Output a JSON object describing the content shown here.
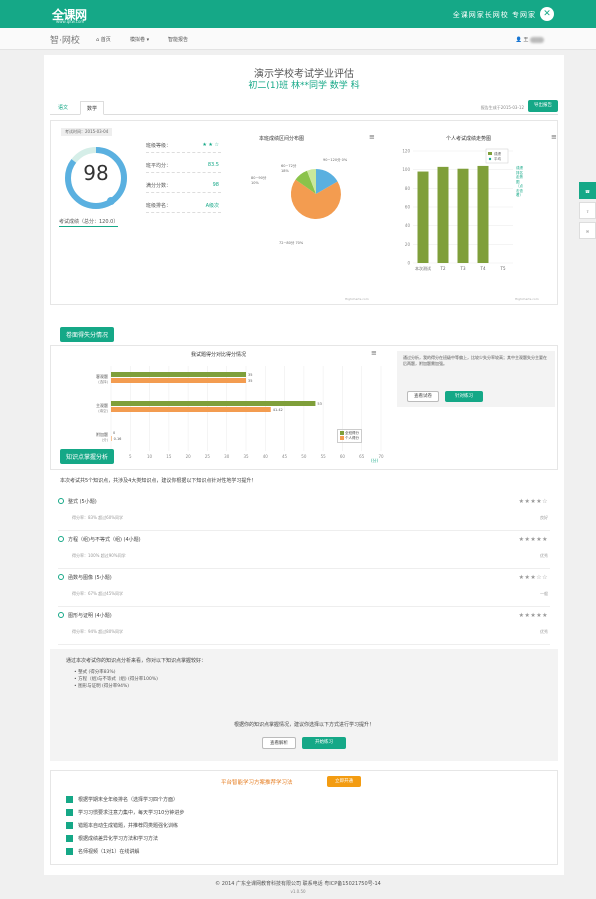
{
  "header": {
    "logo": "全课网",
    "logo_sub": "www.qkw.com",
    "slogan": "全课网家长网校 专网家",
    "close": "✕"
  },
  "nav": {
    "brand": "智·网校",
    "home": "首页",
    "mock": "模拟卷 ▾",
    "report": "智能报告",
    "user": "王"
  },
  "report": {
    "title": "演示学校考试学业评估",
    "subtitle": "初二(1)班 林**同学 数学 科",
    "tabs": [
      "语文",
      "数学"
    ],
    "generated": "报告生成于2015-03-12",
    "export_btn": "导出报告",
    "exam_time": "考试时间：2015-03-04",
    "score": "98",
    "score_label": "考试成绩（总分：120.0）",
    "stats": [
      {
        "k": "班级等级：",
        "v": "★ ★ ☆"
      },
      {
        "k": "班平均分：",
        "v": "83.5"
      },
      {
        "k": "满分分数：",
        "v": "98"
      },
      {
        "k": "班级排名：",
        "v": "A级次"
      }
    ],
    "pie": {
      "title": "本班成绩区间分布图",
      "labels": [
        "90~120分 0%",
        "80~90分 10%",
        "72~80分 70%",
        "60~72分 18%"
      ],
      "credit": "Highcharts.com"
    },
    "bar1": {
      "title": "个人考试成绩走势图",
      "legend": [
        "成绩",
        "平均"
      ],
      "ylabels": [
        "120",
        "100",
        "80",
        "60",
        "40",
        "20",
        "0"
      ],
      "xlabels": [
        "本次测试",
        "T2",
        "T3",
        "T4",
        "T5"
      ],
      "side": "成绩排名走势图 （点击查看）",
      "credit": "Highcharts.com"
    }
  },
  "section1": {
    "tag": "卷面得失分情况",
    "chart_title": "我试题得分对比得分情况",
    "rows": [
      {
        "l1": "客观题",
        "l2": "(选择)"
      },
      {
        "l1": "主观题",
        "l2": "(填空)"
      },
      {
        "l1": "附加题",
        "l2": "(分)"
      }
    ],
    "legend": [
      "全班得分",
      "个人得分"
    ],
    "unit": "(分)",
    "xticks": [
      "0",
      "5",
      "10",
      "15",
      "20",
      "25",
      "30",
      "35",
      "40",
      "45",
      "50",
      "55",
      "60",
      "65",
      "70"
    ],
    "note": "通过分析，我的得分在班级中等偏上，比较少失分率较高；其中主观题失分主要在后两题，附加题需加强。",
    "btn1": "查看试卷",
    "btn2": "针对练习"
  },
  "section2": {
    "tag": "知识点掌握分析",
    "intro": "本次考试共5个知识点，共涉及4大类知识点，建议你根据以下知识点针对性地学习提升！",
    "items": [
      {
        "name": "整式 (5小题)",
        "sub": "得分率：83%  超过60%同学",
        "stars": "★★★★☆",
        "mark": "良好"
      },
      {
        "name": "方程（组)与不等式（组) (4小题)",
        "sub": "得分率：100%  超过90%同学",
        "stars": "★★★★★",
        "mark": "优秀"
      },
      {
        "name": "函数与图像 (5小题)",
        "sub": "得分率：67%  超过45%同学",
        "stars": "★★★☆☆",
        "mark": "一般"
      },
      {
        "name": "图形与证明 (4小题)",
        "sub": "得分率：94%  超过80%同学",
        "stars": "★★★★★",
        "mark": "优秀"
      }
    ],
    "summary": "通过本次考试你的知识点分析来看，你对以下知识点掌握较好：",
    "points": [
      "整式 (得分率83%)",
      "方程（组)与不等式（组) (得分率100%)",
      "图形与证明 (得分率94%)"
    ],
    "tip": "根据你的知识点掌握情况，建议你选择以下方式进行学习提升！",
    "btn1": "查看解析",
    "btn2": "开始练习"
  },
  "plan": {
    "title": "平台智能学习方案推荐学习法",
    "btn": "立即开通",
    "items": [
      "根据学期末全年级排名（选择学习四个方面）",
      "学习习惯要求注意力集中，每天学习10分钟进步",
      "错题本自动生成错题，并推荐同类题强化训练",
      "根据成绩差异化学习方法和学习方法",
      "名师视频（1对1）在线讲解"
    ]
  },
  "footer": {
    "line1": "© 2014 广东全课网教育科技有限公司  联系电话 粤ICP备15021750号-14",
    "line2": "v1.0.50"
  }
}
